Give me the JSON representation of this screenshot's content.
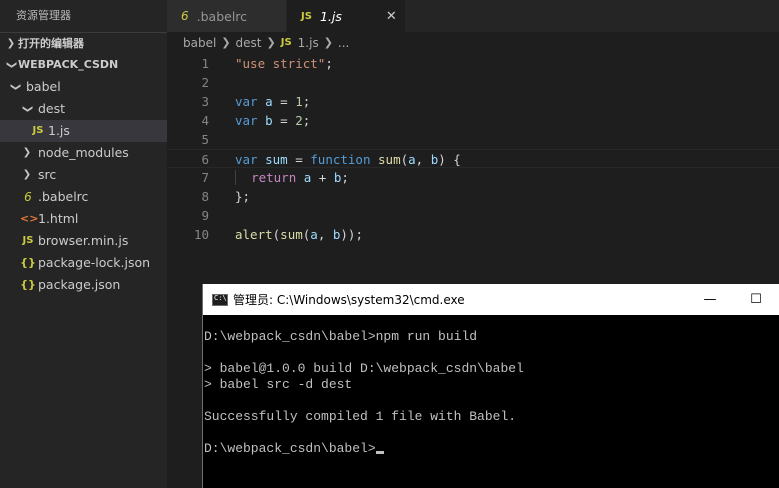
{
  "explorer": {
    "title": "资源管理器",
    "open_editors": "打开的编辑器",
    "project": "WEBPACK_CSDN",
    "tree": [
      {
        "label": "babel",
        "kind": "folder-open",
        "depth": 1
      },
      {
        "label": "dest",
        "kind": "folder-open",
        "depth": 2
      },
      {
        "label": "1.js",
        "kind": "js",
        "depth": 3,
        "selected": true
      },
      {
        "label": "node_modules",
        "kind": "folder",
        "depth": 2
      },
      {
        "label": "src",
        "kind": "folder",
        "depth": 2
      },
      {
        "label": ".babelrc",
        "kind": "babel",
        "depth": 2
      },
      {
        "label": "1.html",
        "kind": "html",
        "depth": 2
      },
      {
        "label": "browser.min.js",
        "kind": "js",
        "depth": 2
      },
      {
        "label": "package-lock.json",
        "kind": "json",
        "depth": 2
      },
      {
        "label": "package.json",
        "kind": "json",
        "depth": 2
      }
    ]
  },
  "tabs": [
    {
      "label": ".babelrc",
      "icon": "6",
      "active": false
    },
    {
      "label": "1.js",
      "icon": "JS",
      "active": true,
      "close": "✕"
    }
  ],
  "breadcrumb": {
    "parts": [
      "babel",
      "dest",
      "1.js",
      "..."
    ],
    "js_badge": "JS"
  },
  "code": {
    "line_numbers": [
      "1",
      "2",
      "3",
      "4",
      "5",
      "6",
      "7",
      "8",
      "9",
      "10"
    ]
  },
  "cmd": {
    "title": "管理员: C:\\Windows\\system32\\cmd.exe",
    "minimize": "—",
    "maximize": "☐",
    "lines": [
      "D:\\webpack_csdn\\babel>npm run build",
      "",
      "> babel@1.0.0 build D:\\webpack_csdn\\babel",
      "> babel src -d dest",
      "",
      "Successfully compiled 1 file with Babel.",
      "",
      "D:\\webpack_csdn\\babel>"
    ]
  },
  "colors": {
    "editor_bg": "#1e1e1e",
    "sidebar_bg": "#252526",
    "keyword": "#569cd6",
    "string": "#ce9178",
    "variable": "#9cdcfe",
    "number": "#b5cea8",
    "function": "#dcdcaa",
    "js_icon": "#cbcb41"
  },
  "icons": {
    "folder_open": "chevron-down-icon",
    "folder_closed": "chevron-right-icon",
    "js_file": "js-file-icon",
    "babel_file": "babel-icon",
    "html_file": "html-icon",
    "json_file": "json-icon",
    "cmd": "terminal-icon"
  }
}
